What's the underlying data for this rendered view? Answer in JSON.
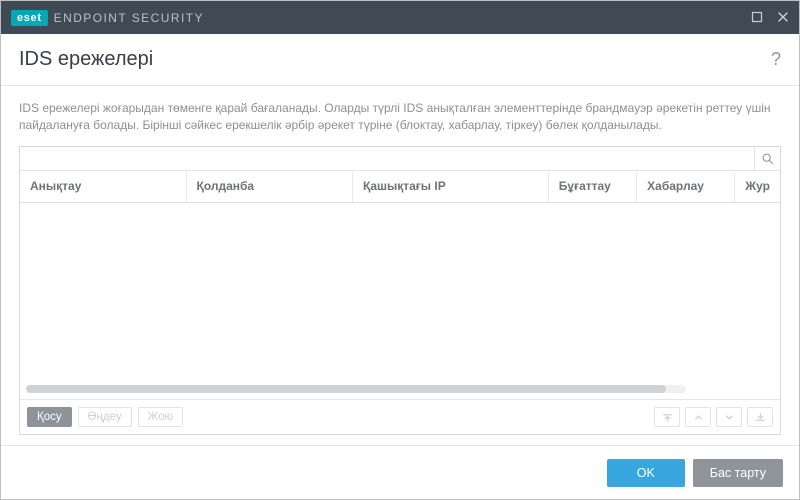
{
  "titlebar": {
    "brand_badge": "eset",
    "brand_text": "ENDPOINT SECURITY"
  },
  "header": {
    "title": "IDS ережелері"
  },
  "body": {
    "description": "IDS ережелері жоғарыдан төменге қарай бағаланады. Оларды түрлі IDS анықталған элементтерінде брандмауэр әрекетін реттеу үшін пайдалануға болады. Бірінші сәйкес ерекшелік әрбір әрекет түріне (блоктау, хабарлау, тіркеу) бөлек қолданылады."
  },
  "table": {
    "columns": {
      "c1": "Анықтау",
      "c2": "Қолданба",
      "c3": "Қашықтағы IP",
      "c4": "Бұғаттау",
      "c5": "Хабарлау",
      "c6": "Жур"
    },
    "rows": []
  },
  "actions": {
    "add": "Қосу",
    "edit": "Өңдеу",
    "delete": "Жою"
  },
  "footer": {
    "ok": "OK",
    "cancel": "Бас тарту"
  }
}
